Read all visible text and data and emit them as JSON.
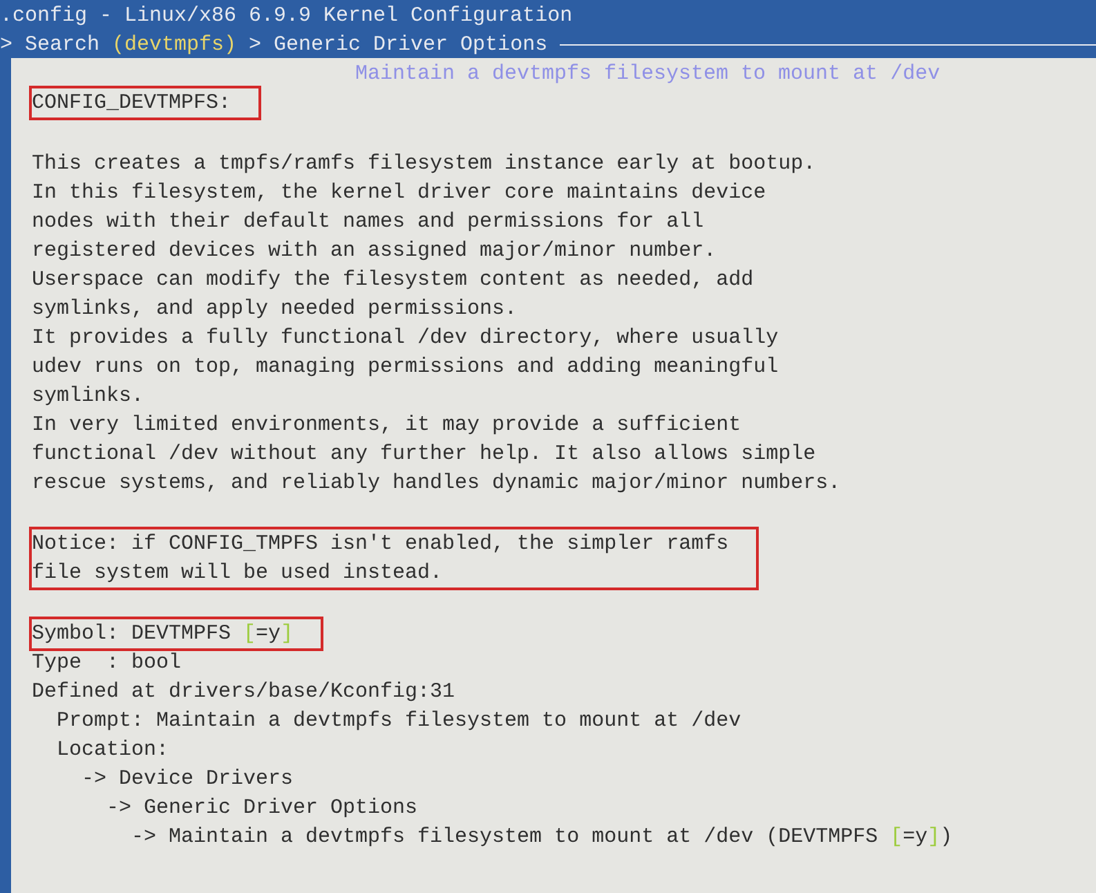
{
  "window": {
    "title": ".config - Linux/x86 6.9.9 Kernel Configuration"
  },
  "breadcrumb": [
    {
      "text": "> Search ",
      "kind": "plain"
    },
    {
      "text": "(devtmpfs)",
      "kind": "accent"
    },
    {
      "text": " > Generic Driver Options",
      "kind": "plain"
    }
  ],
  "dialog": {
    "title": "Maintain a devtmpfs filesystem to mount at /dev",
    "blocks": [
      {
        "kind": "paragraph",
        "highlighted": true,
        "lines": [
          "CONFIG_DEVTMPFS:"
        ]
      },
      {
        "kind": "paragraph",
        "highlighted": false,
        "lines": [
          "This creates a tmpfs/ramfs filesystem instance early at bootup.",
          "In this filesystem, the kernel driver core maintains device",
          "nodes with their default names and permissions for all",
          "registered devices with an assigned major/minor number.",
          "Userspace can modify the filesystem content as needed, add",
          "symlinks, and apply needed permissions.",
          "It provides a fully functional /dev directory, where usually",
          "udev runs on top, managing permissions and adding meaningful",
          "symlinks.",
          "In very limited environments, it may provide a sufficient",
          "functional /dev without any further help. It also allows simple",
          "rescue systems, and reliably handles dynamic major/minor numbers."
        ]
      },
      {
        "kind": "paragraph",
        "highlighted": true,
        "lines": [
          "Notice: if CONFIG_TMPFS isn't enabled, the simpler ramfs",
          "file system will be used instead."
        ]
      },
      {
        "kind": "paragraph",
        "highlighted": true,
        "lines": [
          [
            {
              "text": "Symbol: DEVTMPFS ",
              "kind": "plain"
            },
            {
              "text": "[",
              "kind": "bracket"
            },
            {
              "text": "=y",
              "kind": "plain"
            },
            {
              "text": "]",
              "kind": "bracket"
            }
          ]
        ]
      },
      {
        "kind": "continuation",
        "highlighted": false,
        "lines": [
          "Type  : bool",
          "Defined at drivers/base/Kconfig:31",
          "  Prompt: Maintain a devtmpfs filesystem to mount at /dev",
          "  Location:",
          "    -> Device Drivers",
          "      -> Generic Driver Options",
          [
            {
              "text": "        -> Maintain a devtmpfs filesystem to mount at /dev (DEVTMPFS ",
              "kind": "plain"
            },
            {
              "text": "[",
              "kind": "bracket"
            },
            {
              "text": "=y",
              "kind": "plain"
            },
            {
              "text": "]",
              "kind": "bracket"
            },
            {
              "text": ")",
              "kind": "plain"
            }
          ]
        ]
      }
    ]
  }
}
